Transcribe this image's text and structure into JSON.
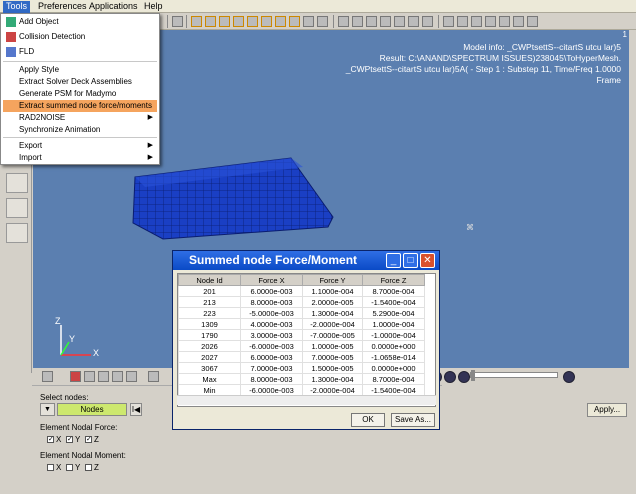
{
  "menubar": {
    "items": [
      "Tools",
      "Preferences",
      "Applications",
      "Help"
    ]
  },
  "tools_menu": {
    "items": [
      {
        "label": "Add Object",
        "icon": "add-object-icon",
        "submenu": false
      },
      {
        "label": "Collision Detection",
        "icon": "collision-icon",
        "submenu": false
      },
      {
        "label": "FLD",
        "icon": "fld-icon",
        "submenu": false
      },
      {
        "label": "Apply Style",
        "submenu": false
      },
      {
        "label": "Extract Solver Deck Assemblies",
        "submenu": false
      },
      {
        "label": "Generate PSM for Madymo",
        "submenu": false
      },
      {
        "label": "Extract  summed node force/moments",
        "submenu": false,
        "highlighted": true
      },
      {
        "label": "RAD2NOISE",
        "submenu": true
      },
      {
        "label": "Synchronize Animation",
        "submenu": false
      },
      {
        "label": "Export",
        "submenu": true
      },
      {
        "label": "Import",
        "submenu": true
      }
    ]
  },
  "viewport": {
    "model_info": [
      "Model info: _CWPtsettS--citartS utcu lar)5",
      "Result: C:\\ANAND\\SPECTRUM ISSUES)238045\\ToHyperMesh.",
      "_CWPtsettS--citartS utcu lar)5A( - Step 1 : Substep 11, Time/Freq 1.0000",
      "Frame"
    ],
    "corner_label": "1",
    "axes": {
      "z": "Z",
      "y": "Y",
      "x": "X"
    }
  },
  "panel": {
    "select_nodes_label": "Select nodes:",
    "nodes_value": "Nodes",
    "reverse_label": "I◀",
    "force_label": "Element Nodal Force:",
    "force_checks": [
      {
        "label": "X",
        "checked": true
      },
      {
        "label": "Y",
        "checked": true
      },
      {
        "label": "Z",
        "checked": true
      }
    ],
    "moment_label": "Element Nodal Moment:",
    "moment_checks": [
      {
        "label": "X",
        "checked": false
      },
      {
        "label": "Y",
        "checked": false
      },
      {
        "label": "Z",
        "checked": false
      }
    ],
    "apply_label": "Apply..."
  },
  "dialog": {
    "title": "Summed node Force/Moment",
    "columns": [
      "Node Id",
      "Force X",
      "Force Y",
      "Force Z"
    ],
    "rows": [
      [
        "201",
        "6.0000e-003",
        "1.1000e-004",
        "8.7000e-004"
      ],
      [
        "213",
        "8.0000e-003",
        "2.0000e-005",
        "-1.5400e-004"
      ],
      [
        "223",
        "-5.0000e-003",
        "1.3000e-004",
        "5.2900e-004"
      ],
      [
        "1309",
        "4.0000e-003",
        "-2.0000e-004",
        "1.0000e-004"
      ],
      [
        "1790",
        "3.0000e-003",
        "-7.0000e-005",
        "-1.0000e-004"
      ],
      [
        "2026",
        "-6.0000e-003",
        "1.0000e-005",
        "0.0000e+000"
      ],
      [
        "2027",
        "6.0000e-003",
        "7.0000e-005",
        "-1.0658e-014"
      ],
      [
        "3067",
        "7.0000e-003",
        "1.5000e-005",
        "0.0000e+000"
      ],
      [
        "Max",
        "8.0000e-003",
        "1.3000e-004",
        "8.7000e-004"
      ],
      [
        "Min",
        "-6.0000e-003",
        "-2.0000e-004",
        "-1.5400e-004"
      ]
    ],
    "ok_label": "OK",
    "save_label": "Save As..."
  },
  "colors": {
    "viewport_bg": "#5b7fb0",
    "mesh": "#1a3fc4",
    "title_bar": "#2f6ee5",
    "highlight": "#f5a45e",
    "nodes_field": "#cde86e"
  }
}
